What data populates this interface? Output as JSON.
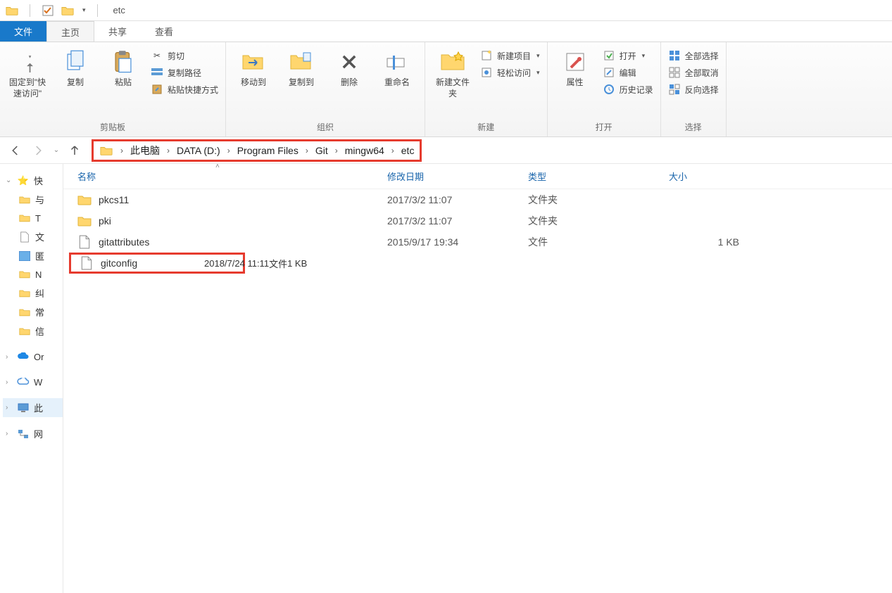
{
  "titlebar": {
    "title": "etc"
  },
  "tabs": {
    "file": "文件",
    "home": "主页",
    "share": "共享",
    "view": "查看"
  },
  "ribbon": {
    "clipboard": {
      "label": "剪贴板",
      "pin": "固定到\"快速访问\"",
      "copy": "复制",
      "paste": "粘贴",
      "cut": "剪切",
      "copypath": "复制路径",
      "pasteshortcut": "粘贴快捷方式"
    },
    "organize": {
      "label": "组织",
      "moveto": "移动到",
      "copyto": "复制到",
      "delete": "删除",
      "rename": "重命名"
    },
    "new": {
      "label": "新建",
      "newfolder": "新建文件夹",
      "newitem": "新建项目",
      "easyaccess": "轻松访问"
    },
    "open": {
      "label": "打开",
      "properties": "属性",
      "open": "打开",
      "edit": "编辑",
      "history": "历史记录"
    },
    "select": {
      "label": "选择",
      "selectall": "全部选择",
      "selectnone": "全部取消",
      "invert": "反向选择"
    }
  },
  "breadcrumb": {
    "items": [
      "此电脑",
      "DATA (D:)",
      "Program Files",
      "Git",
      "mingw64",
      "etc"
    ]
  },
  "columns": {
    "name": "名称",
    "date": "修改日期",
    "type": "类型",
    "size": "大小"
  },
  "rows": [
    {
      "name": "pkcs11",
      "date": "2017/3/2 11:07",
      "type": "文件夹",
      "size": "",
      "kind": "folder"
    },
    {
      "name": "pki",
      "date": "2017/3/2 11:07",
      "type": "文件夹",
      "size": "",
      "kind": "folder"
    },
    {
      "name": "gitattributes",
      "date": "2015/9/17 19:34",
      "type": "文件",
      "size": "1 KB",
      "kind": "file"
    },
    {
      "name": "gitconfig",
      "date": "2018/7/24 11:11",
      "type": "文件",
      "size": "1 KB",
      "kind": "file"
    }
  ],
  "tree": {
    "quick": "快",
    "quick_items": [
      "与",
      "T",
      "文",
      "匿",
      "N",
      "纠",
      "常",
      "信"
    ],
    "onedrive": "Or",
    "wps": "W",
    "thispc": "此",
    "network": "网"
  }
}
